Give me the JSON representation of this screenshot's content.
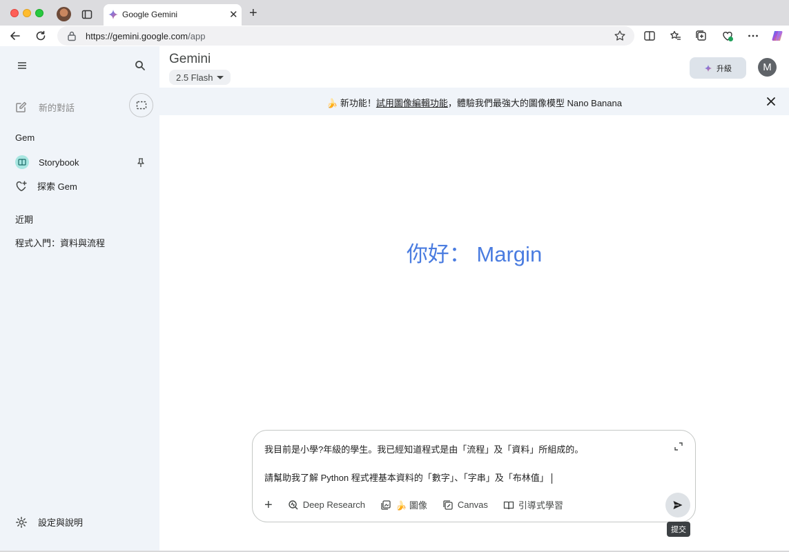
{
  "browser": {
    "tab_title": "Google Gemini",
    "new_tab_symbol": "+",
    "tab_close_symbol": "✕",
    "url_host": "https://gemini.google.com",
    "url_path": "/app"
  },
  "sidebar": {
    "new_chat_label": "新的對話",
    "gem_heading": "Gem",
    "gems": [
      {
        "label": "Storybook",
        "icon": "book-icon",
        "pinned": true
      },
      {
        "label": "探索 Gem",
        "icon": "gem-add-icon"
      }
    ],
    "recent_heading": "近期",
    "recent_items": [
      "程式入門：資料與流程"
    ],
    "settings_label": "設定與說明"
  },
  "header": {
    "app_title": "Gemini",
    "model_label": "2.5 Flash",
    "upgrade_label": "升級",
    "avatar_initial": "M"
  },
  "banner": {
    "emoji": "🍌",
    "prefix": "新功能！",
    "link": "試用圖像編輯功能",
    "suffix": "，體驗我們最強大的圖像模型 Nano Banana"
  },
  "greeting": "你好： Margin",
  "composer": {
    "line1": "我目前是小學?年級的學生。我已經知道程式是由「流程」及「資料」所組成的。",
    "line2": "請幫助我了解 Python 程式裡基本資料的「數字」、「字串」及「布林值」",
    "tools": [
      {
        "label": "Deep Research",
        "icon": "deep-research-icon"
      },
      {
        "label": "🍌 圖像",
        "icon": "image-icon"
      },
      {
        "label": "Canvas",
        "icon": "canvas-icon"
      },
      {
        "label": "引導式學習",
        "icon": "guided-learning-icon"
      }
    ],
    "add_symbol": "+",
    "send_tooltip": "提交"
  },
  "colors": {
    "accent_blue": "#4a7ce0",
    "sidebar_bg": "#f0f4f9",
    "gem_badge": "#a8e6e1"
  }
}
